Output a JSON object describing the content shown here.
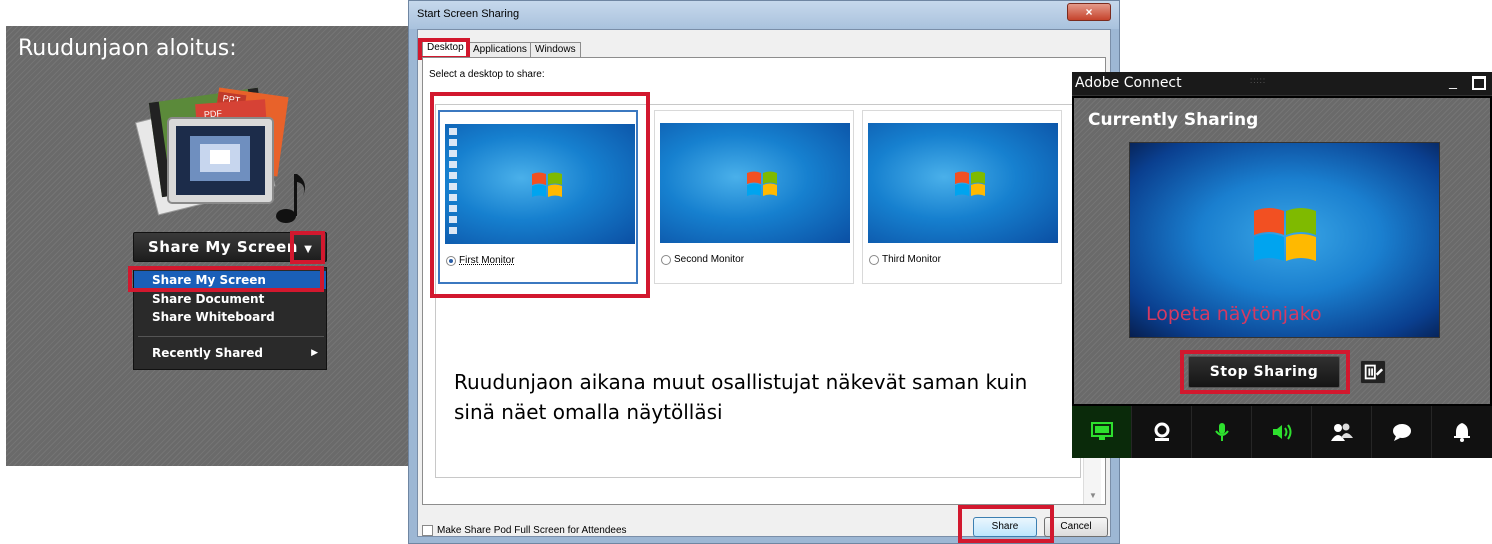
{
  "left_panel": {
    "title": "Ruudunjaon aloitus:",
    "share_button_label": "Share My Screen",
    "menu_items": [
      "Share My Screen",
      "Share Document",
      "Share Whiteboard"
    ],
    "recently_shared": "Recently Shared"
  },
  "dialog": {
    "title": "Start Screen Sharing",
    "tabs": [
      "Desktop",
      "Applications",
      "Windows"
    ],
    "select_label": "Select a desktop to share:",
    "monitors": [
      "First Monitor",
      "Second Monitor",
      "Third Monitor"
    ],
    "selected_monitor": "First Monitor",
    "info_text": "Ruudunjaon aikana muut osallistujat näkevät saman kuin sinä näet omalla näytölläsi",
    "fullscreen_checkbox": "Make Share Pod Full Screen for Attendees",
    "share_label": "Share",
    "cancel_label": "Cancel"
  },
  "adobe_connect": {
    "title": "Adobe Connect",
    "status": "Currently Sharing",
    "stop_note": "Lopeta näytönjako",
    "stop_button": "Stop Sharing",
    "toolbar_icons": [
      "screen-share-icon",
      "webcam-icon",
      "microphone-icon",
      "speaker-icon",
      "attendees-icon",
      "chat-icon",
      "notification-bell-icon"
    ],
    "active_color": "#2ee02e"
  },
  "colors": {
    "highlight_red": "#d2182e",
    "menu_selected": "#1a5fb8"
  }
}
